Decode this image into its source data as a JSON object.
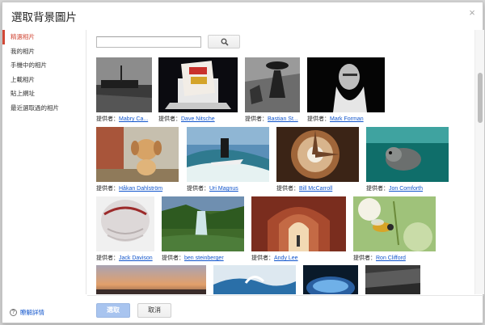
{
  "dialog": {
    "title": "選取背景圖片",
    "close_label": "×"
  },
  "sidebar": {
    "items": [
      {
        "label": "精選相片",
        "active": true
      },
      {
        "label": "我的相片",
        "active": false
      },
      {
        "label": "手機中的相片",
        "active": false
      },
      {
        "label": "上載相片",
        "active": false
      },
      {
        "label": "貼上網址",
        "active": false
      },
      {
        "label": "最近選取過的相片",
        "active": false
      }
    ],
    "help_label": "瞭解詳情",
    "help_icon": "?"
  },
  "search": {
    "value": "",
    "placeholder": "",
    "icon": "search-icon"
  },
  "caption_prefix": "提供者：",
  "photos": [
    {
      "author": "Mabry Ca..."
    },
    {
      "author": "Dave Nitsche"
    },
    {
      "author": "Bastian St..."
    },
    {
      "author": "Mark Forman"
    },
    {
      "author": "Håkan Dahlström"
    },
    {
      "author": "Uri Magnus"
    },
    {
      "author": "Bill McCarroll"
    },
    {
      "author": "Jon Comforth"
    },
    {
      "author": "Jack Davison"
    },
    {
      "author": "ben steinberger"
    },
    {
      "author": "Andy Lee"
    },
    {
      "author": "Ron Clifford"
    },
    {
      "author": ""
    },
    {
      "author": ""
    },
    {
      "author": ""
    },
    {
      "author": ""
    }
  ],
  "footer": {
    "select_label": "選取",
    "cancel_label": "取消"
  },
  "colors": {
    "accent": "#d14836",
    "link": "#1155cc",
    "select_button": "#a8c4ef"
  }
}
